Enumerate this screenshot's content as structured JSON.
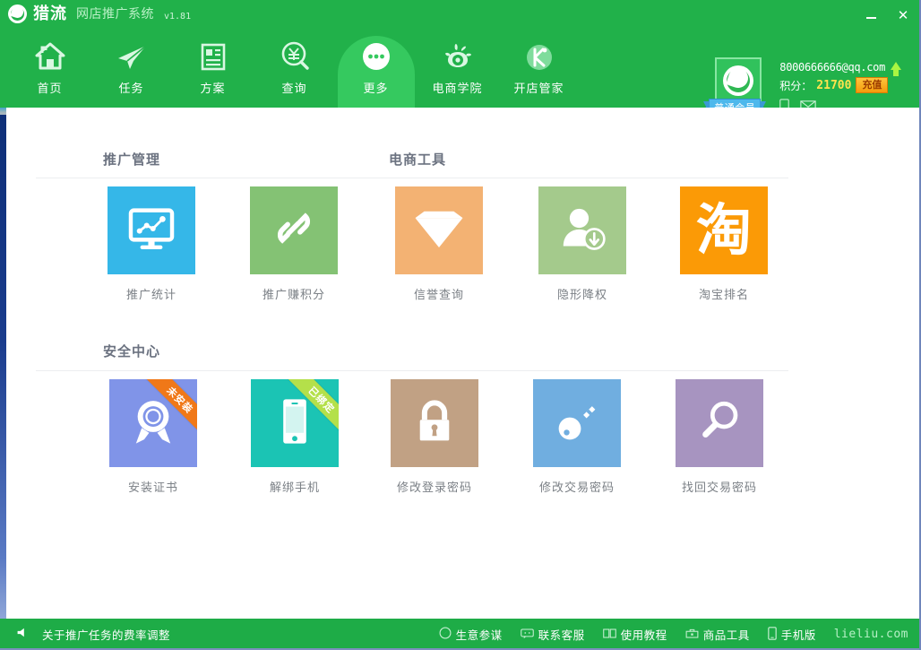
{
  "window": {
    "brand_name": "猎流",
    "brand_sub": "网店推广系统",
    "version": "v1.81",
    "minimize_label": "",
    "close_label": "✕"
  },
  "nav": {
    "items": [
      {
        "label": "首页",
        "icon": "home-icon",
        "active": false
      },
      {
        "label": "任务",
        "icon": "paper-plane-icon",
        "active": false
      },
      {
        "label": "方案",
        "icon": "list-layout-icon",
        "active": false
      },
      {
        "label": "查询",
        "icon": "yuan-search-icon",
        "active": false
      },
      {
        "label": "更多",
        "icon": "ellipsis-icon",
        "active": true
      },
      {
        "label": "电商学院",
        "icon": "sina-eye-icon",
        "active": false
      },
      {
        "label": "开店管家",
        "icon": "k-circle-icon",
        "active": false
      }
    ]
  },
  "account": {
    "membership_badge": "普通会员",
    "email": "8000666666@qq.com",
    "points_label": "积分：",
    "points_value": "21700",
    "recharge_label": "充值",
    "mobile_icon": "mobile-phone-icon",
    "mail_icon": "envelope-icon"
  },
  "sections": [
    {
      "key": "promo",
      "title": "推广管理",
      "tiles": [
        {
          "label": "推广统计",
          "icon": "monitor-chart-icon",
          "color": "#35b7e8",
          "ribbon": null
        },
        {
          "label": "推广赚积分",
          "icon": "chain-link-icon",
          "color": "#84c274",
          "ribbon": null
        }
      ]
    },
    {
      "key": "ectools",
      "title": "电商工具",
      "tiles": [
        {
          "label": "信誉查询",
          "icon": "diamond-icon",
          "color": "#f3b273",
          "ribbon": null
        },
        {
          "label": "隐形降权",
          "icon": "user-down-icon",
          "color": "#a4ca8c",
          "ribbon": null
        },
        {
          "label": "淘宝排名",
          "icon": "taobao-icon",
          "color": "#fb9a06",
          "ribbon": null
        }
      ]
    },
    {
      "key": "security",
      "title": "安全中心",
      "tiles": [
        {
          "label": "安装证书",
          "icon": "certificate-badge-icon",
          "color": "#8094e8",
          "ribbon": {
            "text": "未安装",
            "bg": "#f07818"
          }
        },
        {
          "label": "解绑手机",
          "icon": "smartphone-icon",
          "color": "#1bc4b4",
          "ribbon": {
            "text": "已绑定",
            "bg": "#b4e04a"
          }
        },
        {
          "label": "修改登录密码",
          "icon": "padlock-icon",
          "color": "#c1a184",
          "ribbon": null
        },
        {
          "label": "修改交易密码",
          "icon": "key-icon",
          "color": "#70aee0",
          "ribbon": null
        },
        {
          "label": "找回交易密码",
          "icon": "magnifier-icon",
          "color": "#a794c0",
          "ribbon": null
        }
      ]
    }
  ],
  "footer": {
    "speaker_icon": "speaker-icon",
    "notice": "关于推广任务的费率调整",
    "links": [
      {
        "label": "生意参谋",
        "icon": "compass-icon"
      },
      {
        "label": "联系客服",
        "icon": "chat-bubble-icon"
      },
      {
        "label": "使用教程",
        "icon": "book-icon"
      },
      {
        "label": "商品工具",
        "icon": "toolbox-icon"
      },
      {
        "label": "手机版",
        "icon": "phone-icon"
      }
    ],
    "site": "lieliu.com"
  },
  "colors": {
    "brand_green": "#21b14a",
    "nav_active_green": "#35c95f",
    "footer_green": "#1eac47",
    "accent_yellow": "#ffe34d"
  }
}
